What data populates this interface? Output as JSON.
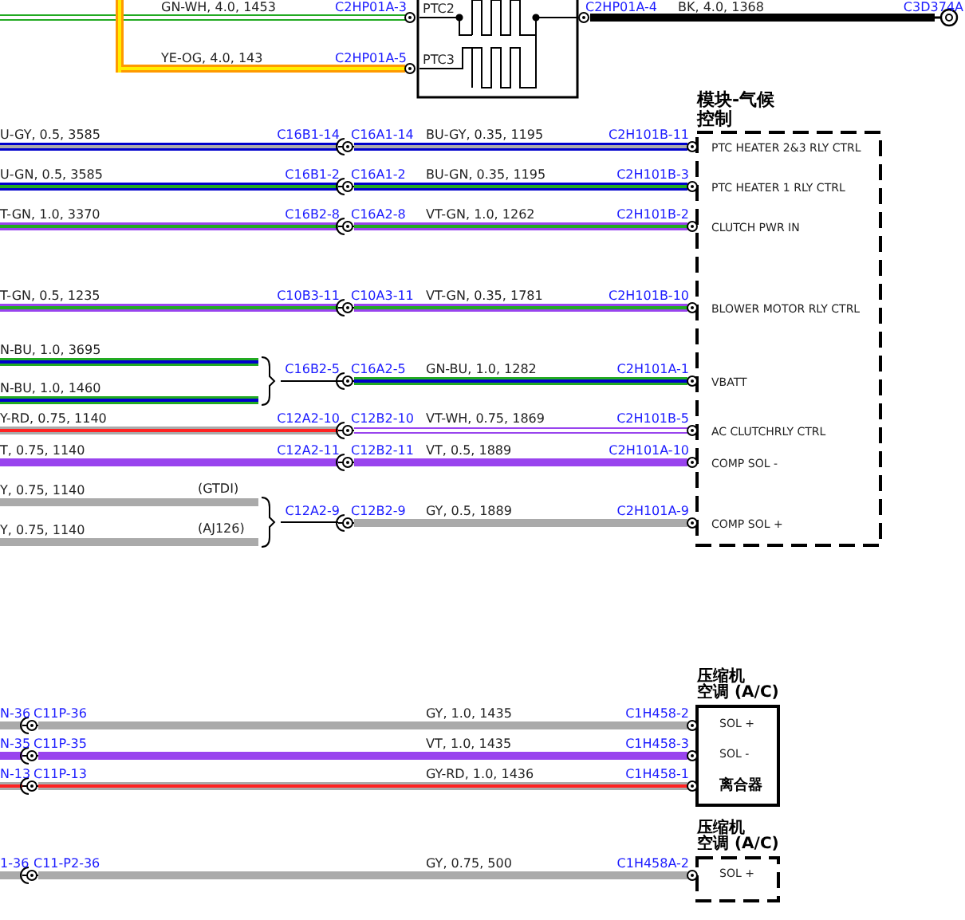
{
  "heater": {
    "inputs": [
      {
        "label": "GN-WH, 4.0, 1453",
        "connector": "C2HP01A-3",
        "pin": "PTC2",
        "color": "#22aa22",
        "stripe": {
          "color": "#ffffff"
        }
      },
      {
        "label": "YE-OG, 4.0, 143",
        "connector": "C2HP01A-5",
        "pin": "PTC3",
        "color": "#ff9900",
        "stripe": {
          "color": "#ffee00"
        }
      }
    ],
    "output": {
      "connector": "C2HP01A-4",
      "label": "BK, 4.0, 1368",
      "color": "#000000",
      "ground_connector": "C3D374A"
    }
  },
  "climate_module": {
    "title_lines": [
      "模块-气候",
      "控制"
    ],
    "dashed": true,
    "rows": [
      {
        "left": [
          {
            "label": "U-GY, 0.5, 3585",
            "color": "#0000cc",
            "stripe": {
              "color": "#aaaaaa"
            }
          }
        ],
        "left_connector": "C16B1-14",
        "right_connector": "C16A1-14",
        "right": {
          "label": "BU-GY, 0.35, 1195",
          "color": "#0000cc",
          "stripe": {
            "color": "#aaaaaa"
          }
        },
        "end_connector": "C2H101B-11",
        "pin": "PTC HEATER 2&3 RLY CTRL"
      },
      {
        "left": [
          {
            "label": "U-GN, 0.5, 3585",
            "color": "#0000cc",
            "stripe": {
              "color": "#22aa22"
            }
          }
        ],
        "left_connector": "C16B1-2",
        "right_connector": "C16A1-2",
        "right": {
          "label": "BU-GN, 0.35, 1195",
          "color": "#0000cc",
          "stripe": {
            "color": "#22aa22"
          }
        },
        "end_connector": "C2H101B-3",
        "pin": "PTC HEATER 1 RLY CTRL"
      },
      {
        "left": [
          {
            "label": "T-GN, 1.0, 3370",
            "color": "#9944ee",
            "stripe": {
              "color": "#22aa22"
            }
          }
        ],
        "left_connector": "C16B2-8",
        "right_connector": "C16A2-8",
        "right": {
          "label": "VT-GN, 1.0, 1262",
          "color": "#9944ee",
          "stripe": {
            "color": "#22aa22"
          }
        },
        "end_connector": "C2H101B-2",
        "pin": "CLUTCH PWR IN"
      },
      {
        "left": [
          {
            "label": "T-GN, 0.5, 1235",
            "color": "#9944ee",
            "stripe": {
              "color": "#22aa22"
            }
          }
        ],
        "left_connector": "C10B3-11",
        "right_connector": "C10A3-11",
        "right": {
          "label": "VT-GN, 0.35, 1781",
          "color": "#9944ee",
          "stripe": {
            "color": "#22aa22"
          }
        },
        "end_connector": "C2H101B-10",
        "pin": "BLOWER MOTOR RLY CTRL"
      },
      {
        "left": [
          {
            "label": "N-BU, 1.0, 3695",
            "color": "#22aa22",
            "stripe": {
              "color": "#0000cc"
            }
          },
          {
            "label": "N-BU, 1.0, 1460",
            "color": "#22aa22",
            "stripe": {
              "color": "#0000cc"
            }
          }
        ],
        "left_connector": "C16B2-5",
        "right_connector": "C16A2-5",
        "right": {
          "label": "GN-BU, 1.0, 1282",
          "color": "#22aa22",
          "stripe": {
            "color": "#0000cc"
          }
        },
        "end_connector": "C2H101A-1",
        "pin": "VBATT"
      },
      {
        "left": [
          {
            "label": "Y-RD, 0.75, 1140",
            "color": "#aaaaaa",
            "stripe": {
              "color": "#ff2222"
            }
          }
        ],
        "left_connector": "C12A2-10",
        "right_connector": "C12B2-10",
        "right": {
          "label": "VT-WH, 0.75, 1869",
          "color": "#9944ee",
          "stripe": {
            "color": "#ffffff"
          }
        },
        "end_connector": "C2H101B-5",
        "pin": "AC CLUTCHRLY CTRL"
      },
      {
        "left": [
          {
            "label": "T, 0.75, 1140",
            "color": "#9944ee"
          }
        ],
        "left_connector": "C12A2-11",
        "right_connector": "C12B2-11",
        "right": {
          "label": "VT, 0.5, 1889",
          "color": "#9944ee"
        },
        "end_connector": "C2H101A-10",
        "pin": "COMP SOL -"
      },
      {
        "left": [
          {
            "label": "Y, 0.75, 1140",
            "note": "(GTDI)",
            "color": "#aaaaaa"
          },
          {
            "label": "Y, 0.75, 1140",
            "note": "(AJ126)",
            "color": "#aaaaaa"
          }
        ],
        "left_connector": "C12A2-9",
        "right_connector": "C12B2-9",
        "right": {
          "label": "GY, 0.5, 1889",
          "color": "#aaaaaa"
        },
        "end_connector": "C2H101A-9",
        "pin": "COMP SOL +"
      }
    ]
  },
  "compressor_modules": [
    {
      "title_lines": [
        "压缩机",
        "空调 (A/C)"
      ],
      "dashed": false,
      "pins": [
        {
          "text": "SOL +",
          "kind": "pin"
        },
        {
          "text": "SOL -",
          "kind": "pin"
        },
        {
          "text": "离合器",
          "kind": "component"
        }
      ],
      "wires": [
        {
          "left_label": "N-36",
          "left_connector": "C11P-36",
          "label": "GY, 1.0, 1435",
          "end_connector": "C1H458-2",
          "color": "#aaaaaa"
        },
        {
          "left_label": "N-35",
          "left_connector": "C11P-35",
          "label": "VT, 1.0, 1435",
          "end_connector": "C1H458-3",
          "color": "#9944ee"
        },
        {
          "left_label": "N-13",
          "left_connector": "C11P-13",
          "label": "GY-RD, 1.0, 1436",
          "end_connector": "C1H458-1",
          "color": "#aaaaaa",
          "stripe": {
            "color": "#ff2222"
          }
        }
      ]
    },
    {
      "title_lines": [
        "压缩机",
        "空调 (A/C)"
      ],
      "dashed": true,
      "pins": [
        {
          "text": "SOL +",
          "kind": "pin"
        }
      ],
      "wires": [
        {
          "left_label": "1-36",
          "left_connector": "C11-P2-36",
          "label": "GY, 0.75, 500",
          "end_connector": "C1H458A-2",
          "color": "#aaaaaa"
        }
      ]
    }
  ]
}
